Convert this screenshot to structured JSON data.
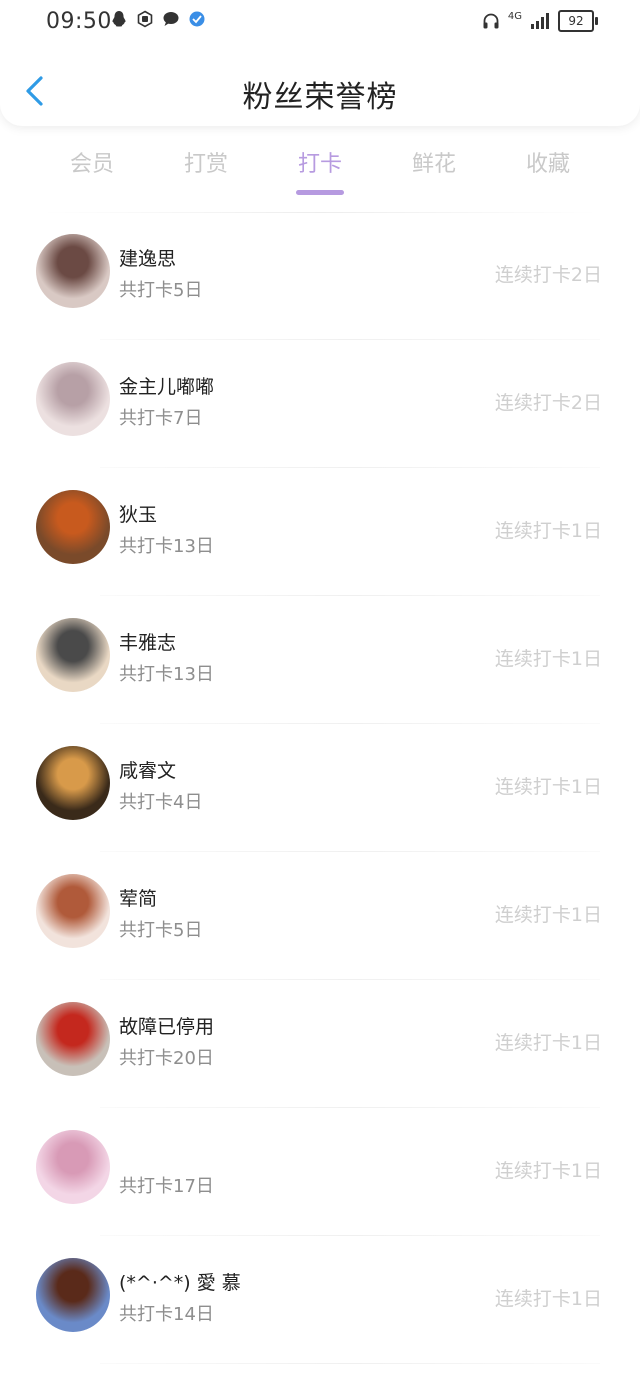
{
  "status_bar": {
    "time": "09:50",
    "network": "4G",
    "battery": "92"
  },
  "header": {
    "title": "粉丝荣誉榜",
    "back_icon": "chevron-left-icon"
  },
  "tabs": [
    {
      "label": "会员",
      "active": false
    },
    {
      "label": "打赏",
      "active": false
    },
    {
      "label": "打卡",
      "active": true
    },
    {
      "label": "鲜花",
      "active": false
    },
    {
      "label": "收藏",
      "active": false
    }
  ],
  "colors": {
    "accent": "#b69ae0",
    "back_arrow": "#2f9be6",
    "inactive_tab": "#c9c9c9",
    "streak_text": "#cfcfcf"
  },
  "fans": [
    {
      "name": "建逸思",
      "total": "共打卡5日",
      "streak": "连续打卡2日",
      "avatar": [
        "#d9c9c4",
        "#6b4a44"
      ]
    },
    {
      "name": "金主儿嘟嘟",
      "total": "共打卡7日",
      "streak": "连续打卡2日",
      "avatar": [
        "#ece0e0",
        "#b7a0a6"
      ]
    },
    {
      "name": "狄玉",
      "total": "共打卡13日",
      "streak": "连续打卡1日",
      "avatar": [
        "#7a4a2a",
        "#c85a1e"
      ]
    },
    {
      "name": "丰雅志",
      "total": "共打卡13日",
      "streak": "连续打卡1日",
      "avatar": [
        "#e9d8c4",
        "#4a4a4a"
      ]
    },
    {
      "name": "咸睿文",
      "total": "共打卡4日",
      "streak": "连续打卡1日",
      "avatar": [
        "#3a2a1a",
        "#d89a4a"
      ]
    },
    {
      "name": "荤简",
      "total": "共打卡5日",
      "streak": "连续打卡1日",
      "avatar": [
        "#f2e3dc",
        "#b05a3a"
      ]
    },
    {
      "name": "故障已停用",
      "total": "共打卡20日",
      "streak": "连续打卡1日",
      "avatar": [
        "#c8c0b8",
        "#c4281e"
      ]
    },
    {
      "name": "",
      "total": "共打卡17日",
      "streak": "连续打卡1日",
      "avatar": [
        "#f3d6e6",
        "#d89ab6"
      ]
    },
    {
      "name": "(*^·^*) 愛 慕",
      "total": "共打卡14日",
      "streak": "连续打卡1日",
      "avatar": [
        "#6a8ac8",
        "#5a2a1a"
      ]
    }
  ]
}
